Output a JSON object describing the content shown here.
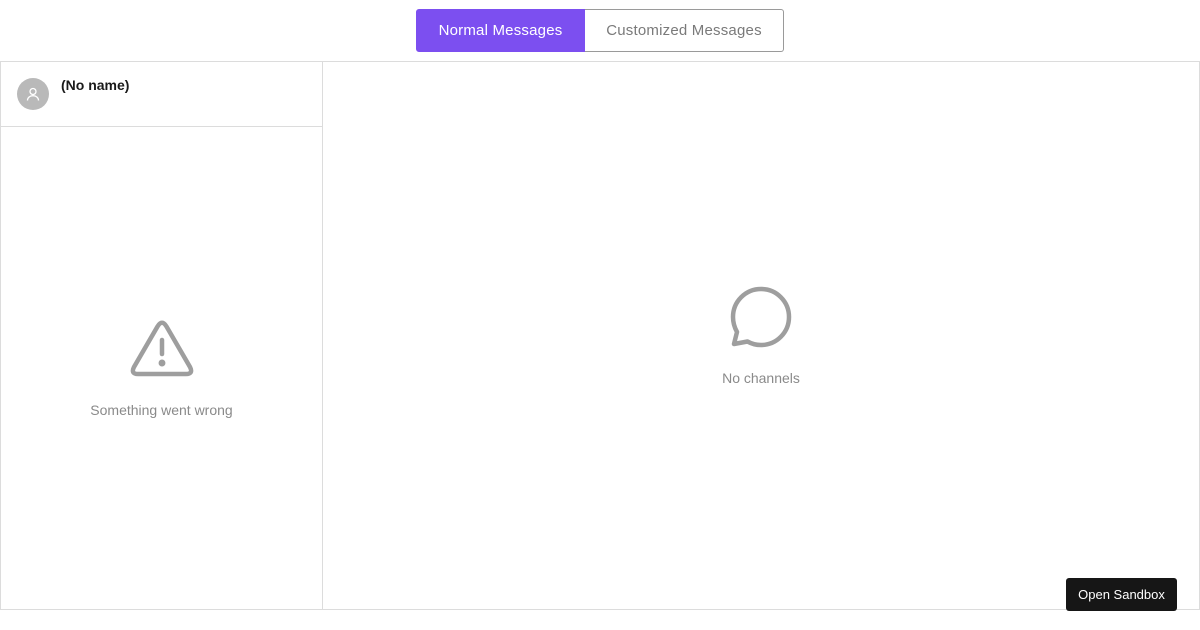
{
  "tabs": [
    {
      "label": "Normal Messages",
      "active": true
    },
    {
      "label": "Customized Messages",
      "active": false
    }
  ],
  "sidebar": {
    "user_name": "(No name)",
    "avatar_icon": "user-icon",
    "empty_state": {
      "icon": "warning-triangle-icon",
      "text": "Something went wrong"
    }
  },
  "main": {
    "empty_state": {
      "icon": "chat-bubble-icon",
      "text": "No channels"
    }
  },
  "sandbox_button": {
    "label": "Open Sandbox"
  },
  "colors": {
    "accent": "#7c4ff0",
    "muted_text": "#8a8a8a",
    "border": "#dcdcdc",
    "icon_gray": "#9e9e9e",
    "button_dark": "#161616"
  }
}
